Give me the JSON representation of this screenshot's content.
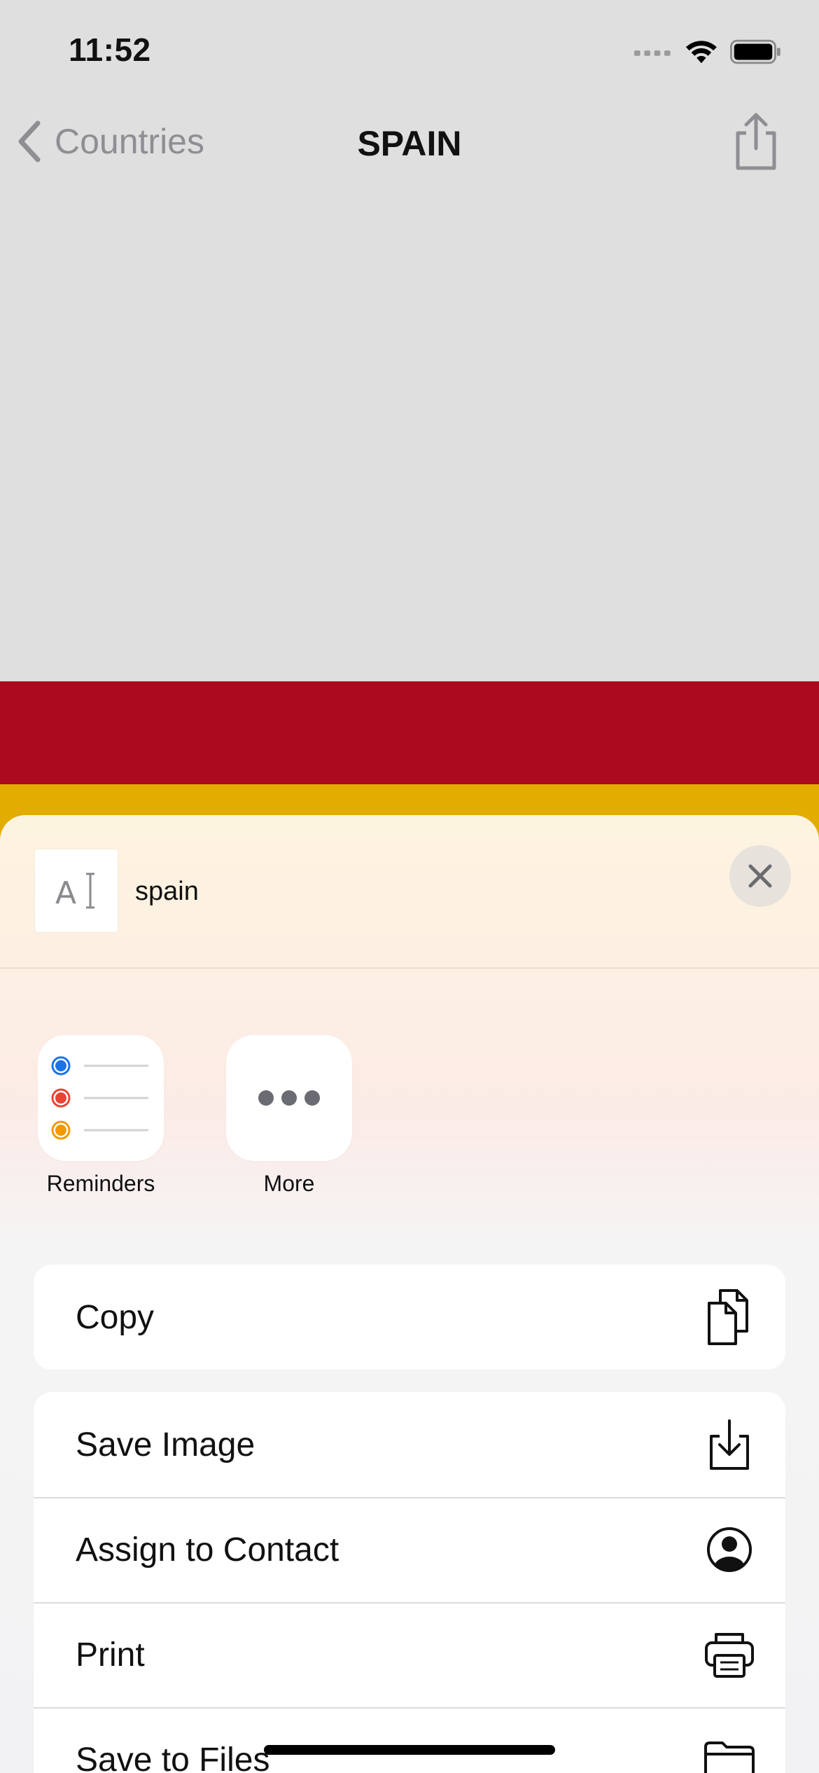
{
  "status_bar": {
    "time": "11:52"
  },
  "nav": {
    "back_label": "Countries",
    "title": "SPAIN"
  },
  "flag": {
    "red": "#ab0b1c",
    "yellow": "#e2ac00"
  },
  "share_sheet": {
    "preview_title": "spain",
    "apps": [
      {
        "label": "Reminders",
        "icon": "reminders-icon"
      },
      {
        "label": "More",
        "icon": "more-icon"
      }
    ],
    "actions_group1": [
      {
        "label": "Copy",
        "icon": "copy-icon"
      }
    ],
    "actions_group2": [
      {
        "label": "Save Image",
        "icon": "save-image-icon"
      },
      {
        "label": "Assign to Contact",
        "icon": "contact-icon"
      },
      {
        "label": "Print",
        "icon": "printer-icon"
      },
      {
        "label": "Save to Files",
        "icon": "folder-icon"
      }
    ]
  }
}
